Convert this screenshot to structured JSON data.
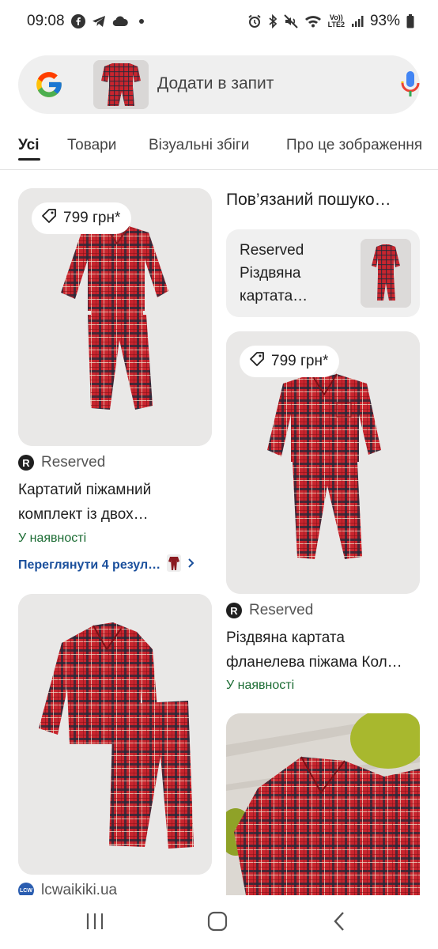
{
  "status_bar": {
    "time": "09:08",
    "lte_line1": "Vo))",
    "lte_line2": "LTE2",
    "battery": "93%"
  },
  "search": {
    "placeholder": "Додати в запит"
  },
  "tabs": [
    {
      "label": "Усі",
      "active": true
    },
    {
      "label": "Товари",
      "active": false
    },
    {
      "label": "Візуальні збіги",
      "active": false
    },
    {
      "label": "Про це зображення",
      "active": false
    }
  ],
  "results": {
    "left": [
      {
        "price": "799 грн*",
        "source": "Reserved",
        "title_line1": "Картатий піжамний",
        "title_line2": "комплект із двох…",
        "stock": "У наявності",
        "more": "Переглянути 4 резул…"
      },
      {
        "source": "lcwaikiki.ua"
      }
    ],
    "right": {
      "section_title": "Пов’язаний пошуко…",
      "related_line1": "Reserved",
      "related_line2": "Різдвяна",
      "related_line3": "картата…",
      "price": "799 грн*",
      "source": "Reserved",
      "title_line1": "Різдвяна картата",
      "title_line2": "фланелева піжама Кол…",
      "stock": "У наявності"
    }
  },
  "colors": {
    "accent_green": "#1a6b32",
    "link_blue": "#1a4f9c",
    "plaid_red": "#c8252e"
  }
}
